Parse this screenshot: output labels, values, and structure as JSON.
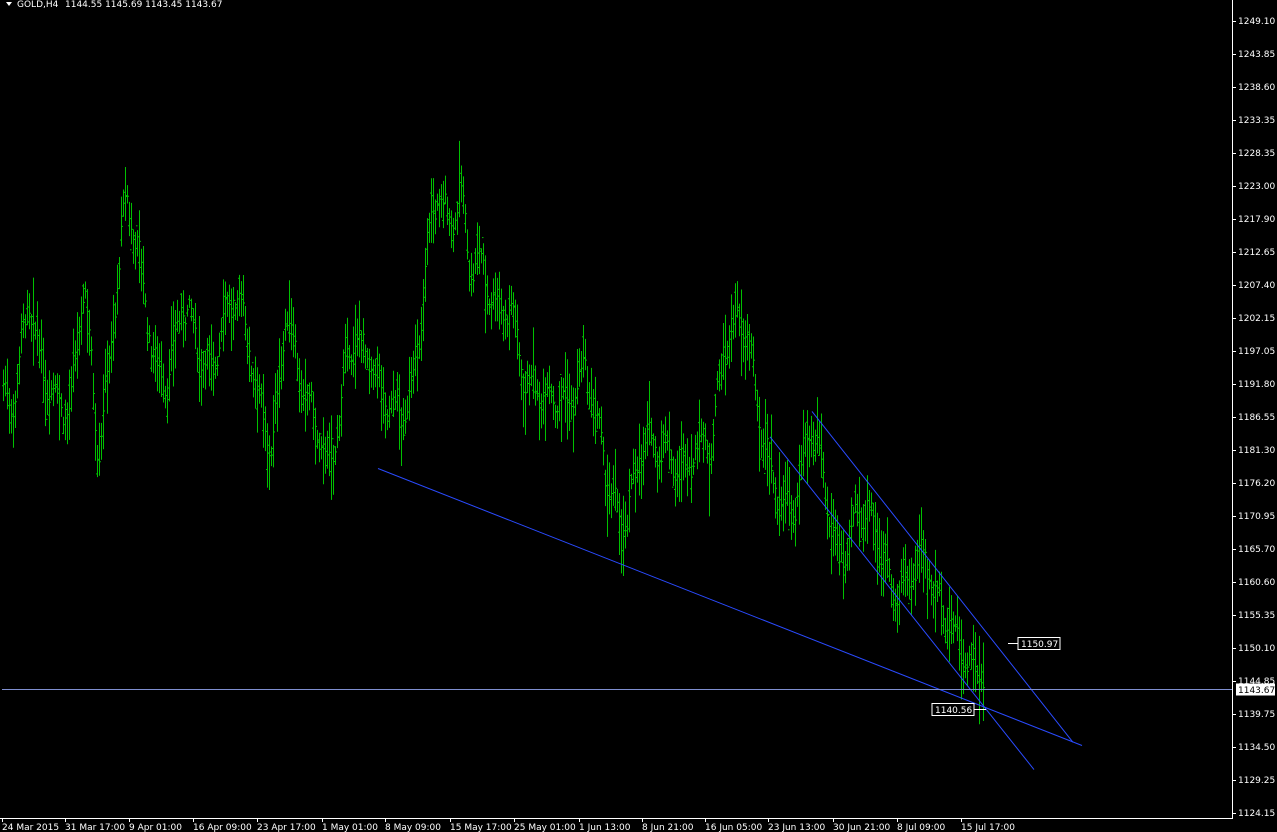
{
  "symbol_header": {
    "symbol": "GOLD,H4",
    "ohlc": "1144.55 1145.69 1143.45 1143.67"
  },
  "colors": {
    "background": "#000000",
    "candles": "#00c000",
    "trendlines": "#2a4bff",
    "bid_line": "#7f8fd0",
    "axis": "#ffffff",
    "text": "#ffffff"
  },
  "chart_data": {
    "type": "line",
    "title": "GOLD,H4",
    "bar_style": "OHLC bars",
    "ylim": [
      1124.15,
      1251.0
    ],
    "y_ticks": [
      "1249.10",
      "1243.85",
      "1238.60",
      "1233.35",
      "1228.35",
      "1223.00",
      "1217.90",
      "1212.65",
      "1207.40",
      "1202.15",
      "1197.05",
      "1191.80",
      "1186.55",
      "1181.30",
      "1176.20",
      "1170.95",
      "1165.70",
      "1160.60",
      "1155.35",
      "1150.10",
      "1144.85",
      "1139.75",
      "1134.50",
      "1129.25",
      "1124.15"
    ],
    "x_ticks": [
      "24 Mar 2015",
      "31 Mar 17:00",
      "9 Apr 01:00",
      "16 Apr 09:00",
      "23 Apr 17:00",
      "1 May 01:00",
      "8 May 09:00",
      "15 May 17:00",
      "25 May 01:00",
      "1 Jun 13:00",
      "8 Jun 21:00",
      "16 Jun 05:00",
      "23 Jun 13:00",
      "30 Jun 21:00",
      "8 Jul 09:00",
      "15 Jul 17:00"
    ],
    "price_path": {
      "x_index": [
        0,
        14,
        28,
        42,
        56,
        70,
        84,
        98,
        112,
        126,
        140,
        154,
        168,
        182,
        196,
        210,
        224,
        240,
        258,
        272,
        286,
        300,
        314,
        330,
        350,
        370,
        390,
        405,
        418,
        428,
        438,
        450,
        460,
        470,
        480,
        495,
        510,
        525,
        540,
        556,
        570,
        585,
        598,
        612,
        626,
        640,
        655,
        668,
        682,
        695,
        710,
        725,
        738,
        748,
        758,
        770,
        782,
        795,
        808,
        820,
        832,
        845,
        858,
        872,
        885,
        898,
        910,
        922,
        935,
        948,
        960,
        972,
        984
      ],
      "close": [
        1190,
        1187,
        1205,
        1196,
        1190,
        1185,
        1208,
        1183,
        1200,
        1220,
        1210,
        1197,
        1193,
        1203,
        1198,
        1195,
        1204,
        1203,
        1190,
        1183,
        1204,
        1190,
        1186,
        1180,
        1197,
        1195,
        1190,
        1186,
        1195,
        1215,
        1224,
        1218,
        1222,
        1208,
        1210,
        1206,
        1205,
        1190,
        1190,
        1192,
        1189,
        1192,
        1184,
        1175,
        1170,
        1180,
        1182,
        1183,
        1178,
        1180,
        1181,
        1200,
        1203,
        1198,
        1185,
        1178,
        1175,
        1173,
        1183,
        1178,
        1169,
        1166,
        1172,
        1169,
        1163,
        1160,
        1162,
        1164,
        1157,
        1156,
        1152,
        1147,
        1143.67
      ]
    },
    "trendlines": [
      {
        "from": {
          "x_index": 378,
          "price": 1178.5
        },
        "to": {
          "x_index": 1082,
          "price": 1134.8
        }
      },
      {
        "from": {
          "x_index": 770,
          "price": 1183.5
        },
        "to": {
          "x_index": 1034,
          "price": 1131.0
        }
      },
      {
        "from": {
          "x_index": 812,
          "price": 1187.5
        },
        "to": {
          "x_index": 1073,
          "price": 1135.3
        }
      }
    ],
    "price_labels": [
      {
        "text": "1150.97",
        "price": 1150.97
      },
      {
        "text": "1140.56",
        "price": 1140.56
      }
    ],
    "current_price": {
      "text": "1143.67",
      "price": 1143.67
    }
  }
}
